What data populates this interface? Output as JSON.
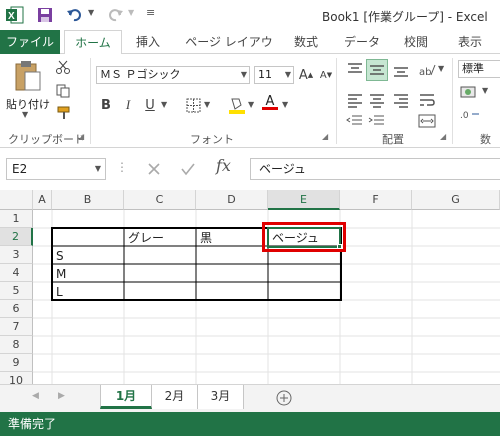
{
  "titlebar": {
    "title": "Book1  [作業グループ] - Excel"
  },
  "tabs": [
    "ファイル",
    "ホーム",
    "挿入",
    "ページ レイアウト",
    "数式",
    "データ",
    "校閲",
    "表示"
  ],
  "ribbon": {
    "paste_label": "貼り付け",
    "clipboard_label": "クリップボード",
    "font_name": "ＭＳ Ｐゴシック",
    "font_size": "11",
    "font_group_label": "フォント",
    "align_group_label": "配置",
    "number_format": "標準",
    "number_group_label": "数値",
    "bold": "B",
    "italic": "I",
    "underline": "U",
    "grow_font": "A",
    "shrink_font": "A"
  },
  "formula": {
    "namebox": "E2",
    "fx": "fx",
    "content": "ベージュ"
  },
  "columns": [
    "A",
    "B",
    "C",
    "D",
    "E",
    "F",
    "G"
  ],
  "rows": [
    "1",
    "2",
    "3",
    "4",
    "5",
    "6",
    "7",
    "8",
    "9",
    "10"
  ],
  "cells": {
    "C2": "グレー",
    "D2": "黒",
    "E2": "ベージュ",
    "B3": "S",
    "B4": "M",
    "B5": "L"
  },
  "sheets": [
    "1月",
    "2月",
    "3月"
  ],
  "status": "準備完了",
  "colors": {
    "accent": "#217346",
    "selection": "#e00000"
  }
}
